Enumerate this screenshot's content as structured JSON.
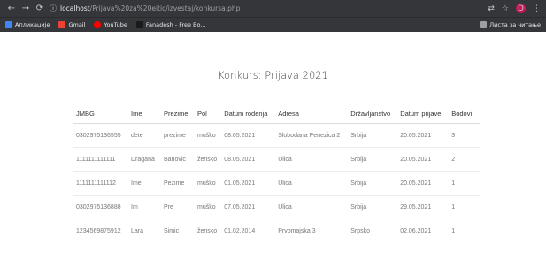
{
  "browser": {
    "url_host": "localhost",
    "url_path": "/Prijava%20za%20eitic/izvestaj/konkursa.php",
    "profile_initial": "D"
  },
  "bookmarks": {
    "items": [
      {
        "label": "Апликације",
        "icon_color": "#5f6368"
      },
      {
        "label": "Gmail",
        "icon_color": "#ea4335"
      },
      {
        "label": "YouTube",
        "icon_color": "#ff0000"
      },
      {
        "label": "Fanadesh - Free Bo...",
        "icon_color": "#1a1a1a"
      }
    ],
    "reading_list": "Листа за читање"
  },
  "page": {
    "title": "Konkurs: Prijava 2021"
  },
  "table": {
    "headers": [
      "JMBG",
      "Ime",
      "Prezime",
      "Pol",
      "Datum rodenja",
      "Adresa",
      "Državljanstvo",
      "Datum prijave",
      "Bodovi"
    ],
    "rows": [
      [
        "0302975136555",
        "dete",
        "prezime",
        "muško",
        "08.05.2021",
        "Slobodana Penezica 2",
        "Srbija",
        "20.05.2021",
        "3"
      ],
      [
        "1111111111111",
        "Dragana",
        "Banovic",
        "žensko",
        "08.05.2021",
        "Ulica",
        "Srbija",
        "20.05.2021",
        "2"
      ],
      [
        "1111111111112",
        "Ime",
        "Pezime",
        "muško",
        "01.05.2021",
        "Ulica",
        "Srbija",
        "20.05.2021",
        "1"
      ],
      [
        "0302975136888",
        "Im",
        "Pre",
        "muško",
        "07.05.2021",
        "Ulica",
        "Srbija",
        "29.05.2021",
        "1"
      ],
      [
        "1234569875912",
        "Lara",
        "Simic",
        "žensko",
        "01.02.2014",
        "Prvomajska 3",
        "Srpsko",
        "02.06.2021",
        "1"
      ]
    ]
  }
}
